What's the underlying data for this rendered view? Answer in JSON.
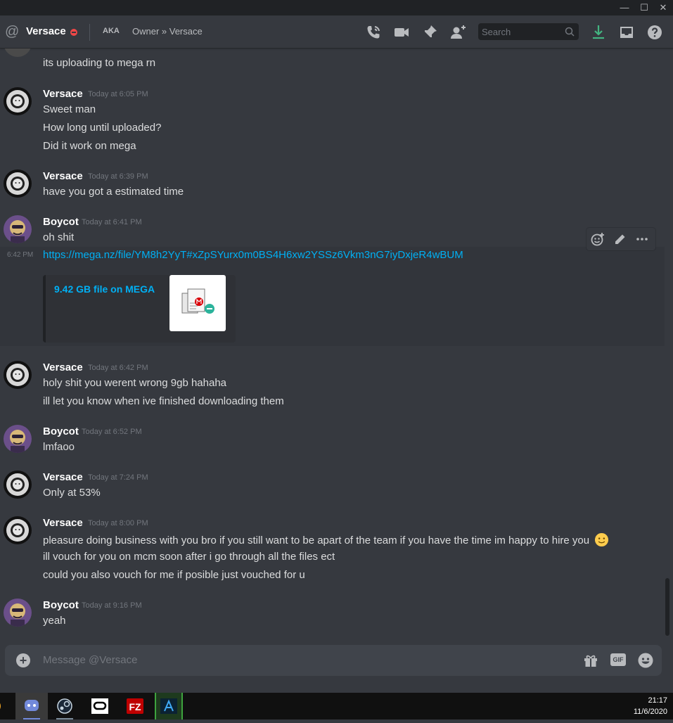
{
  "window": {
    "minimize": "—",
    "maximize": "☐",
    "close": "✕"
  },
  "header": {
    "name": "Versace",
    "aka_label": "AKA",
    "aka_names": "Owner » Versace",
    "search_placeholder": "Search"
  },
  "messages": [
    {
      "lines": [
        "its uploading to mega rn"
      ]
    },
    {
      "author": "Versace",
      "timestamp": "Today at 6:05 PM",
      "lines": [
        "Sweet man",
        "How long until uploaded?",
        "Did it work on mega"
      ]
    },
    {
      "author": "Versace",
      "timestamp": "Today at 6:39 PM",
      "lines": [
        "have you got a estimated time"
      ]
    },
    {
      "author": "Boycot",
      "timestamp": "Today at 6:41 PM",
      "lines": [
        "oh shit"
      ]
    },
    {
      "side_timestamp": "6:42 PM",
      "link": "https://mega.nz/file/YM8h2YyT#xZpSYurx0m0BS4H6xw2YSSz6Vkm3nG7iyDxjeR4wBUM",
      "embed_title": "9.42 GB file on MEGA"
    },
    {
      "author": "Versace",
      "timestamp": "Today at 6:42 PM",
      "lines": [
        "holy shit you werent wrong 9gb hahaha",
        "ill let you know when ive finished downloading them"
      ]
    },
    {
      "author": "Boycot",
      "timestamp": "Today at 6:52 PM",
      "lines": [
        "lmfaoo"
      ]
    },
    {
      "author": "Versace",
      "timestamp": "Today at 7:24 PM",
      "lines": [
        "Only at 53%"
      ]
    },
    {
      "author": "Versace",
      "timestamp": "Today at 8:00 PM",
      "lines": [
        "pleasure doing business with you bro if you still want to be apart of the team if you have the time im happy to hire you",
        "ill vouch for you on mcm soon after i go through all the files ect",
        "could you also vouch for me if posible just vouched for u"
      ]
    },
    {
      "author": "Boycot",
      "timestamp": "Today at 9:16 PM",
      "lines": [
        "yeah"
      ]
    }
  ],
  "composer": {
    "placeholder": "Message @Versace",
    "gif_label": "GIF"
  },
  "taskbar": {
    "time": "21:17",
    "date": "11/6/2020"
  },
  "colors": {
    "link": "#00b0f4",
    "dnd": "#f04747",
    "download": "#43b581",
    "bg": "#36393f"
  }
}
